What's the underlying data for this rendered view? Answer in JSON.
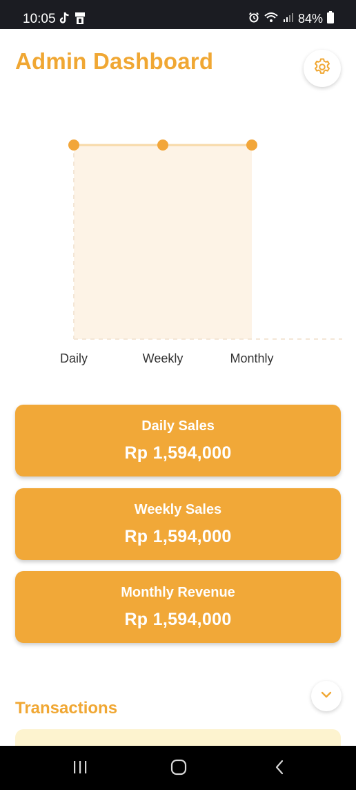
{
  "status_bar": {
    "time": "10:05",
    "battery": "84%",
    "icons": [
      "tiktok-icon",
      "sim-icon",
      "alarm-icon",
      "wifi-icon",
      "signal-icon",
      "battery-icon"
    ]
  },
  "header": {
    "title": "Admin Dashboard",
    "settings_icon": "gear-icon"
  },
  "chart_data": {
    "type": "area",
    "categories": [
      "Daily",
      "Weekly",
      "Monthly"
    ],
    "values": [
      1594000,
      1594000,
      1594000
    ],
    "colors": {
      "line": "#f2a63a",
      "fill": "#fdf3e6"
    }
  },
  "summary_cards": [
    {
      "title": "Daily Sales",
      "value": "Rp 1,594,000"
    },
    {
      "title": "Weekly Sales",
      "value": "Rp 1,594,000"
    },
    {
      "title": "Monthly Revenue",
      "value": "Rp 1,594,000"
    }
  ],
  "transactions": {
    "title": "Transactions",
    "expand_icon": "chevron-down-icon"
  },
  "nav_bar": {
    "items": [
      "recent-apps-icon",
      "home-icon",
      "back-icon"
    ]
  },
  "colors": {
    "accent": "#f0a733",
    "card": "#f1a838",
    "card_light": "#fdf3cf"
  }
}
